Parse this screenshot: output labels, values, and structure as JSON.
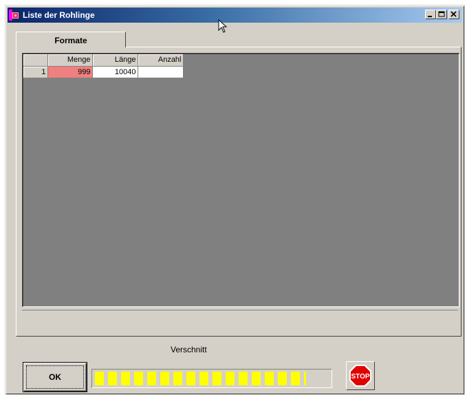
{
  "window": {
    "title": "Liste der Rohlinge",
    "controls": {
      "minimize": "minimize-icon",
      "maximize": "maximize-icon",
      "close": "close-icon"
    }
  },
  "tabs": [
    {
      "label": "Formate",
      "active": true
    }
  ],
  "grid": {
    "columns": [
      "",
      "Menge",
      "Länge",
      "Anzahl"
    ],
    "rows": [
      {
        "index": "1",
        "menge": "999",
        "laenge": "10040",
        "anzahl": ""
      }
    ],
    "highlight_color": "#f08080",
    "background_color": "#808080"
  },
  "progress": {
    "label": "Verschnitt",
    "segments_filled": 17,
    "fill_fraction": 0.92,
    "fill_color": "#ffff00"
  },
  "buttons": {
    "ok_label": "OK",
    "stop_icon": "stop-sign-icon",
    "stop_text": "STOP"
  },
  "colors": {
    "title_bar": "#0a246a",
    "face": "#d4d0c8"
  }
}
